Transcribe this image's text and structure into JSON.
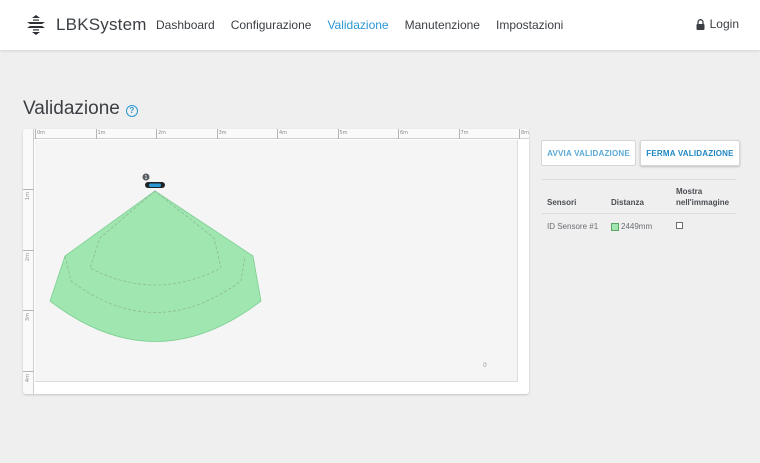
{
  "app": {
    "name": "LBKSystem",
    "logo_icon": "lbk-logo-icon"
  },
  "nav": {
    "items": [
      {
        "label": "Dashboard",
        "active": false
      },
      {
        "label": "Configurazione",
        "active": false
      },
      {
        "label": "Validazione",
        "active": true
      },
      {
        "label": "Manutenzione",
        "active": false
      },
      {
        "label": "Impostazioni",
        "active": false
      }
    ],
    "login_label": "Login"
  },
  "page": {
    "title": "Validazione",
    "help_glyph": "?"
  },
  "canvas": {
    "ruler_top": [
      "0m",
      "1m",
      "2m",
      "3m",
      "4m",
      "5m",
      "6m",
      "7m",
      "8m"
    ],
    "ruler_left": [
      "1m",
      "2m",
      "3m",
      "4m"
    ],
    "corner_value": "0",
    "sensor": {
      "number": "1",
      "field_color": "#9fe6b1",
      "field_stroke": "#7fcf93",
      "body_color": "#2a98d2"
    }
  },
  "actions": {
    "start_label": "AVVIA VALIDAZIONE",
    "stop_label": "FERMA VALIDAZIONE"
  },
  "sensors_table": {
    "headers": {
      "sensor": "Sensori",
      "distance": "Distanza",
      "show_line1": "Mostra",
      "show_line2": "nell'immagine"
    },
    "rows": [
      {
        "sensor": "ID Sensore #1",
        "distance": "2449mm",
        "swatch_color": "#9fe6b1",
        "show_checked": false
      }
    ]
  },
  "colors": {
    "accent": "#2a98d2",
    "background": "#efefef",
    "text": "#3b3f44"
  }
}
